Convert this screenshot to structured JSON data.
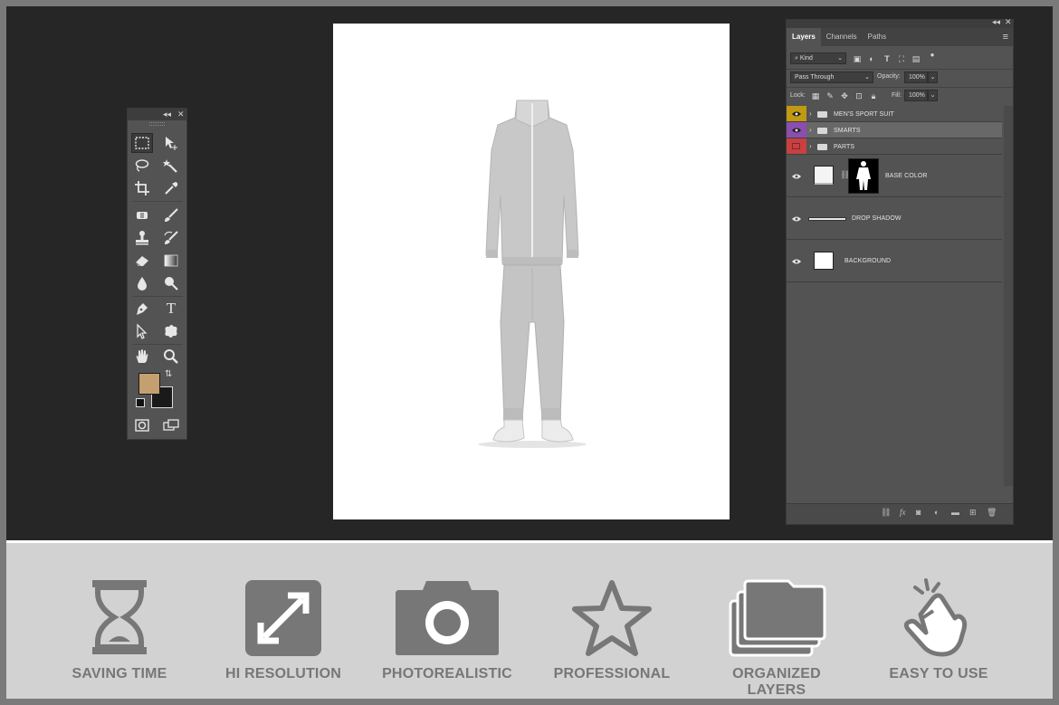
{
  "toolbox": {
    "collapse_icon": "double-chevron-icon",
    "close_icon": "close-icon",
    "tools": [
      {
        "name": "rectangular-marquee-tool",
        "icon": "marquee-icon"
      },
      {
        "name": "move-tool",
        "icon": "move-icon"
      },
      {
        "name": "lasso-tool",
        "icon": "lasso-icon"
      },
      {
        "name": "magic-wand-tool",
        "icon": "magic-wand-icon"
      },
      {
        "name": "crop-tool",
        "icon": "crop-icon"
      },
      {
        "name": "eyedropper-tool",
        "icon": "eyedropper-icon"
      },
      {
        "name": "spot-healing-tool",
        "icon": "bandage-icon"
      },
      {
        "name": "brush-tool",
        "icon": "brush-icon"
      },
      {
        "name": "clone-stamp-tool",
        "icon": "stamp-icon"
      },
      {
        "name": "history-brush-tool",
        "icon": "history-brush-icon"
      },
      {
        "name": "eraser-tool",
        "icon": "eraser-icon"
      },
      {
        "name": "gradient-tool",
        "icon": "gradient-icon"
      },
      {
        "name": "blur-tool",
        "icon": "drop-icon"
      },
      {
        "name": "dodge-tool",
        "icon": "dodge-icon"
      },
      {
        "name": "pen-tool",
        "icon": "pen-icon"
      },
      {
        "name": "type-tool",
        "icon": "type-icon",
        "glyph": "T"
      },
      {
        "name": "path-selection-tool",
        "icon": "arrow-icon"
      },
      {
        "name": "custom-shape-tool",
        "icon": "shape-icon"
      },
      {
        "name": "hand-tool",
        "icon": "hand-icon"
      },
      {
        "name": "zoom-tool",
        "icon": "zoom-icon"
      }
    ],
    "foreground_color": "#c4a070",
    "background_color": "#1a1a1a"
  },
  "layers_panel": {
    "tabs": [
      "Layers",
      "Channels",
      "Paths"
    ],
    "active_tab": "Layers",
    "filter_kind": "Kind",
    "blend_mode": "Pass Through",
    "opacity_label": "Opacity:",
    "opacity_value": "100%",
    "lock_label": "Lock:",
    "fill_label": "Fill:",
    "fill_value": "100%",
    "layers": [
      {
        "name": "MEN'S SPORT SUIT",
        "type": "group",
        "tag_color": "#c09a10",
        "visible": true
      },
      {
        "name": "SMARTS",
        "type": "group",
        "tag_color": "#8a4fae",
        "visible": true,
        "selected": true
      },
      {
        "name": "PARTS",
        "type": "group",
        "tag_color": "#c94040",
        "visible": false
      },
      {
        "name": "BASE COLOR",
        "type": "smart-object-masked",
        "visible": true
      },
      {
        "name": "DROP SHADOW",
        "type": "layer",
        "visible": true
      },
      {
        "name": "BACKGROUND",
        "type": "layer",
        "visible": true
      }
    ],
    "bottom_icons": [
      "link-icon",
      "fx-icon",
      "mask-icon",
      "adjustment-icon",
      "folder-icon",
      "new-layer-icon",
      "trash-icon"
    ]
  },
  "features": [
    {
      "label": "SAVING TIME",
      "icon": "hourglass-icon"
    },
    {
      "label": "HI RESOLUTION",
      "icon": "expand-arrows-icon"
    },
    {
      "label": "PHOTOREALISTIC",
      "icon": "camera-icon"
    },
    {
      "label": "PROFESSIONAL",
      "icon": "star-icon"
    },
    {
      "label": "ORGANIZED LAYERS",
      "icon": "stacked-folders-icon"
    },
    {
      "label": "EASY TO USE",
      "icon": "tap-hand-icon"
    }
  ]
}
